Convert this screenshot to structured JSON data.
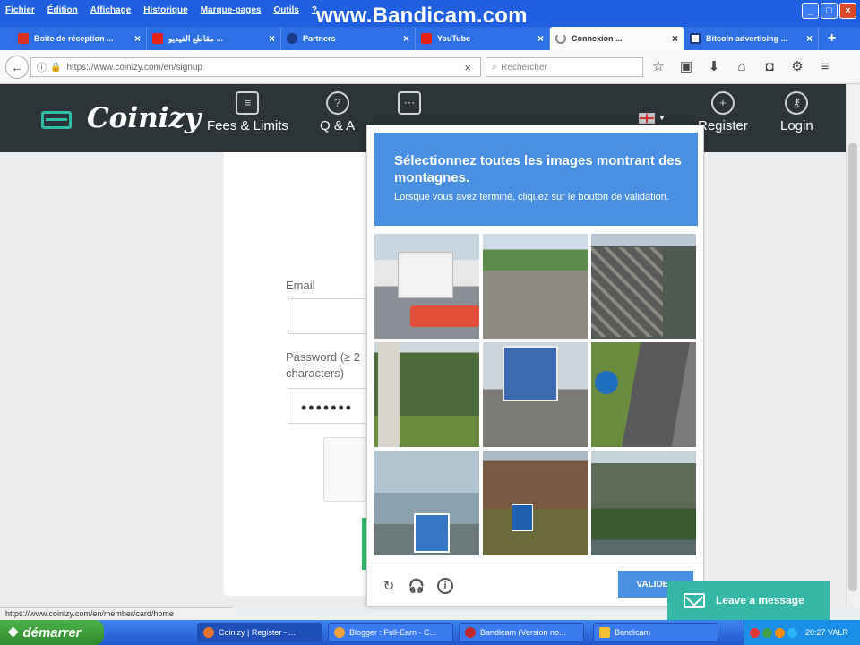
{
  "browser": {
    "menu": [
      "Fichier",
      "Édition",
      "Affichage",
      "Historique",
      "Marque-pages",
      "Outils",
      "?"
    ],
    "watermark": "www.Bandicam.com",
    "tabs": [
      {
        "label": "Boîte de réception ...",
        "icon_color": "#d93025",
        "icon": "gmail-icon"
      },
      {
        "label": "مقاطع الفيديو ...",
        "icon_color": "#e62117",
        "icon": "youtube-icon"
      },
      {
        "label": "Partners",
        "icon_color": "#1a3a8a",
        "icon": "partners-icon"
      },
      {
        "label": "YouTube",
        "icon_color": "#e62117",
        "icon": "youtube-icon"
      },
      {
        "label": "Connexion ...",
        "icon_color": "#888888",
        "icon": "loading-icon",
        "active": true
      },
      {
        "label": "Bitcoin advertising ...",
        "icon_color": "#1f3a8a",
        "icon": "bitcoin-ads-icon"
      }
    ],
    "newtab": "+",
    "url": "https://www.coinizy.com/en/signup",
    "search_placeholder": "Rechercher",
    "status_url": "https://www.coinizy.com/en/member/card/home"
  },
  "site": {
    "logo": "Coinizy",
    "nav": [
      {
        "label": "Fees & Limits",
        "icon": "document-icon"
      },
      {
        "label": "Q & A",
        "icon": "question-icon"
      },
      {
        "label": "",
        "icon": "chat-icon"
      },
      {
        "label": "Register",
        "icon": "add-user-icon"
      },
      {
        "label": "Login",
        "icon": "key-icon"
      }
    ],
    "form": {
      "email_label": "Email",
      "password_label": "Password (≥ 2 characters)",
      "password_value": "•••••••"
    }
  },
  "captcha": {
    "title": "Sélectionnez toutes les images montrant des montagnes.",
    "subtitle": "Lorsque vous avez terminé, cliquez sur le bouton de validation.",
    "verify_label": "VALIDER",
    "footer_icons": [
      "reload-icon",
      "audio-icon",
      "info-icon"
    ]
  },
  "chat": {
    "label": "Leave a message"
  },
  "taskbar": {
    "start_label": "démarrer",
    "items": [
      {
        "label": "Coinizy | Register - ...",
        "icon_color": "#e8742a"
      },
      {
        "label": "Blogger : Full-Earn - C...",
        "icon_color": "#f4a23a"
      },
      {
        "label": "Bandicam (Version no...",
        "icon_color": "#c0282a"
      },
      {
        "label": "Bandicam",
        "icon_color": "#f0c030"
      }
    ],
    "clock": "20:27 VALR",
    "tray_colors": [
      "#e53935",
      "#43a047",
      "#fb8c00",
      "#29b6f6"
    ]
  }
}
